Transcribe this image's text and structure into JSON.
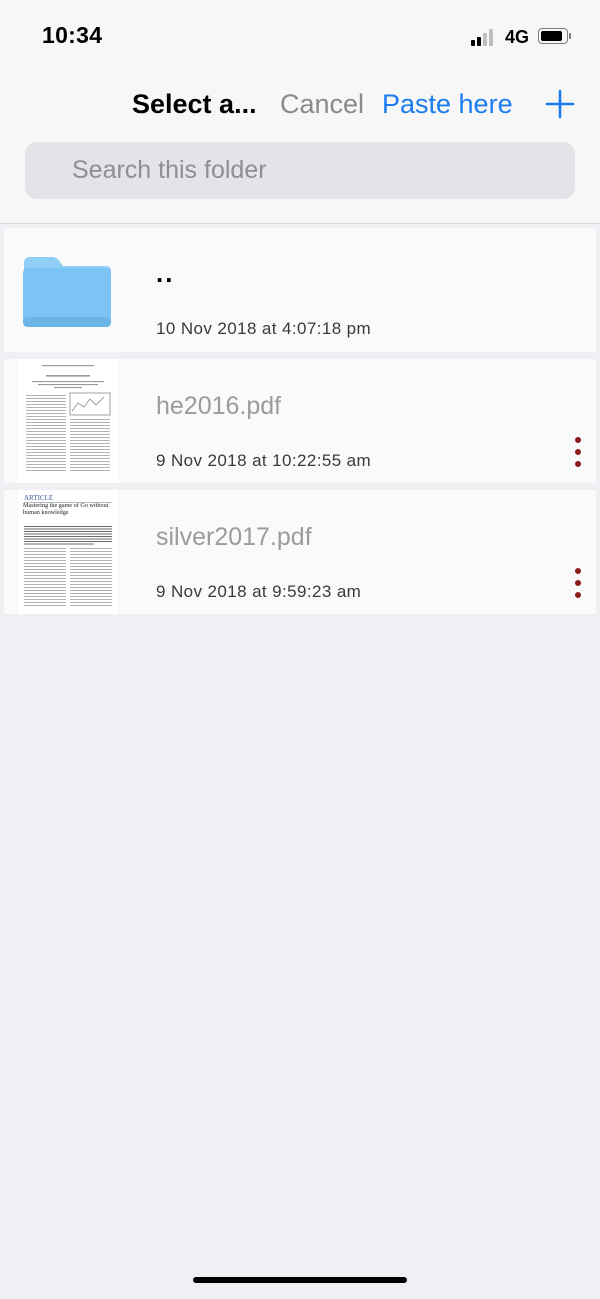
{
  "status_bar": {
    "time": "10:34",
    "network": "4G",
    "signal_bars_active": 2,
    "battery_level": 0.75
  },
  "nav": {
    "title": "Select a...",
    "cancel": "Cancel",
    "paste": "Paste here",
    "add_icon": "plus-icon"
  },
  "search": {
    "placeholder": "Search this folder",
    "value": ""
  },
  "files": [
    {
      "name": "..",
      "date": "10 Nov 2018 at 4:07:18 pm",
      "kind": "folder",
      "icon": "folder-icon"
    },
    {
      "name": "he2016.pdf",
      "date": "9 Nov 2018 at 10:22:55 am",
      "kind": "pdf",
      "icon": "pdf-thumbnail"
    },
    {
      "name": "silver2017.pdf",
      "date": "9 Nov 2018 at 9:59:23 am",
      "kind": "pdf",
      "icon": "pdf-thumbnail",
      "thumb_header": "ARTICLE",
      "thumb_title": "Mastering the game of Go without human knowledge"
    }
  ],
  "colors": {
    "accent": "#1a7cf0",
    "more_dots": "#8a1c1c",
    "folder": "#7cc4f4",
    "background": "#efeff4"
  }
}
